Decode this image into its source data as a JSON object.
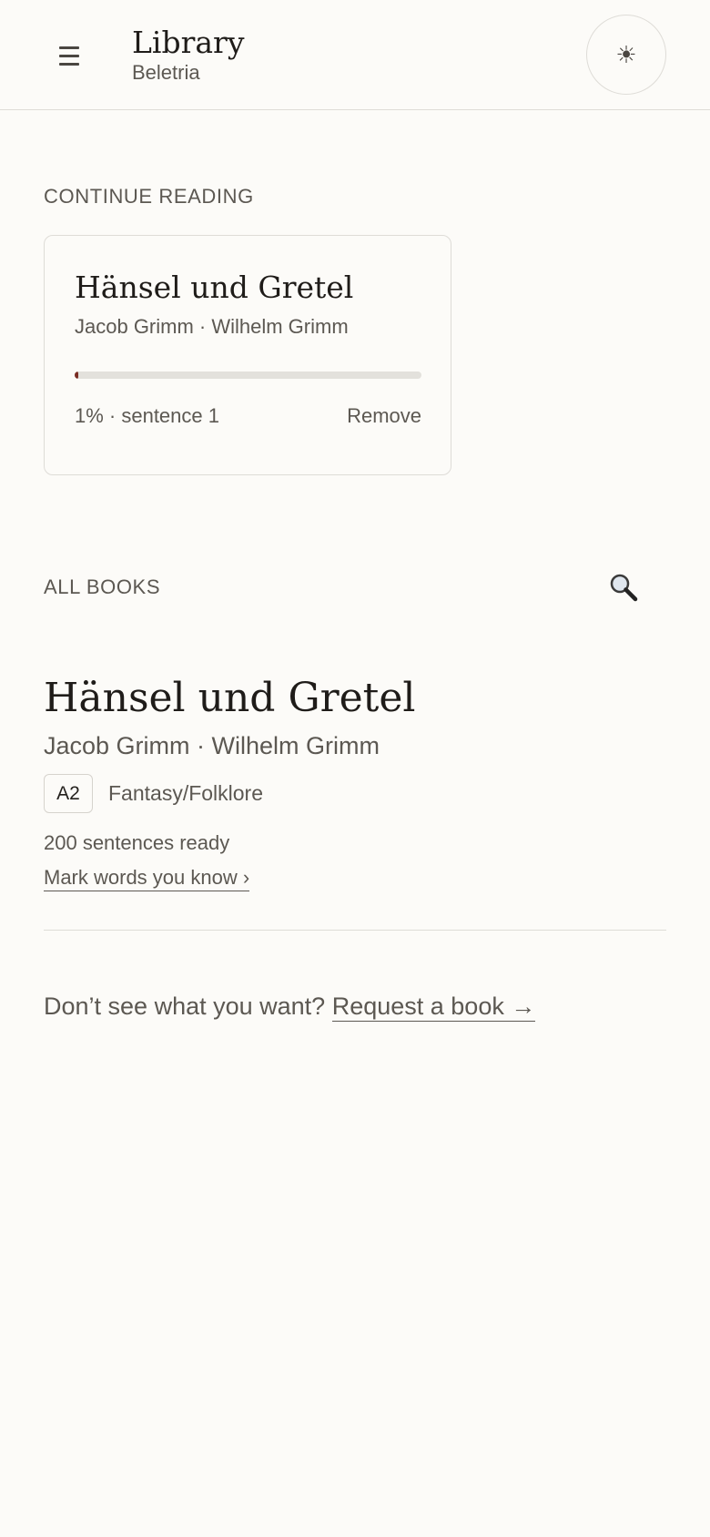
{
  "header": {
    "title": "Library",
    "subtitle": "Beletria",
    "menu_icon": "hamburger-menu-icon",
    "theme_icon": "sun-icon",
    "theme_glyph": "☀"
  },
  "continue_reading": {
    "label": "CONTINUE READING",
    "card": {
      "title": "Hänsel und Gretel",
      "authors": "Jacob Grimm · Wilhelm Grimm",
      "progress_percent": 1,
      "status": "1% · sentence 1",
      "remove_label": "Remove"
    }
  },
  "all_books": {
    "label": "ALL BOOKS",
    "search_icon": "search-icon",
    "books": [
      {
        "title": "Hänsel und Gretel",
        "authors": "Jacob Grimm · Wilhelm Grimm",
        "level": "A2",
        "genre": "Fantasy/Folklore",
        "sentences": "200 sentences ready",
        "mark_link": "Mark words you know ›"
      }
    ]
  },
  "footer": {
    "prompt": "Don’t see what you want?",
    "request_link": "Request a book →"
  },
  "colors": {
    "background": "#fcfbf8",
    "accent": "#7a2d24",
    "muted_text": "#5c5852",
    "border": "#dedcd7"
  }
}
